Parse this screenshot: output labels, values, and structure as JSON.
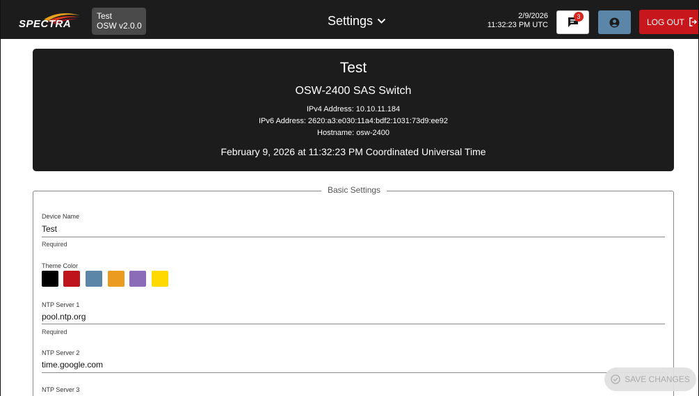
{
  "header": {
    "brand": "SPECTRA",
    "device_name": "Test",
    "device_version": "OSW v2.0.0",
    "page_menu_label": "Settings",
    "date": "2/9/2026",
    "time": "11:32:23 PM UTC",
    "messages_count": "3",
    "logout_label": "LOG OUT"
  },
  "info_card": {
    "name": "Test",
    "model": "OSW-2400 SAS Switch",
    "ipv4": "IPv4 Address: 10.10.11.184",
    "ipv6": "IPv6 Address: 2620:a3:e030:11a4:bdf2:1031:73d9:ee92",
    "hostname": "Hostname: osw-2400",
    "datetime": "February 9, 2026 at 11:32:23 PM Coordinated Universal Time"
  },
  "basic_settings": {
    "legend": "Basic Settings",
    "device_name": {
      "label": "Device Name",
      "value": "Test",
      "helper": "Required"
    },
    "theme_color": {
      "label": "Theme Color",
      "swatches": [
        "#000000",
        "#c0141c",
        "#5b86a7",
        "#ec9b21",
        "#8a6cb8",
        "#ffd900"
      ]
    },
    "ntp1": {
      "label": "NTP Server 1",
      "value": "pool.ntp.org",
      "helper": "Required"
    },
    "ntp2": {
      "label": "NTP Server 2",
      "value": "time.google.com"
    },
    "ntp3": {
      "label": "NTP Server 3"
    }
  },
  "save_button": {
    "label": "SAVE CHANGES"
  },
  "colors": {
    "header_bg": "#1c1c1c",
    "accent_blue": "#5b86a7",
    "danger_red": "#c8161d"
  }
}
